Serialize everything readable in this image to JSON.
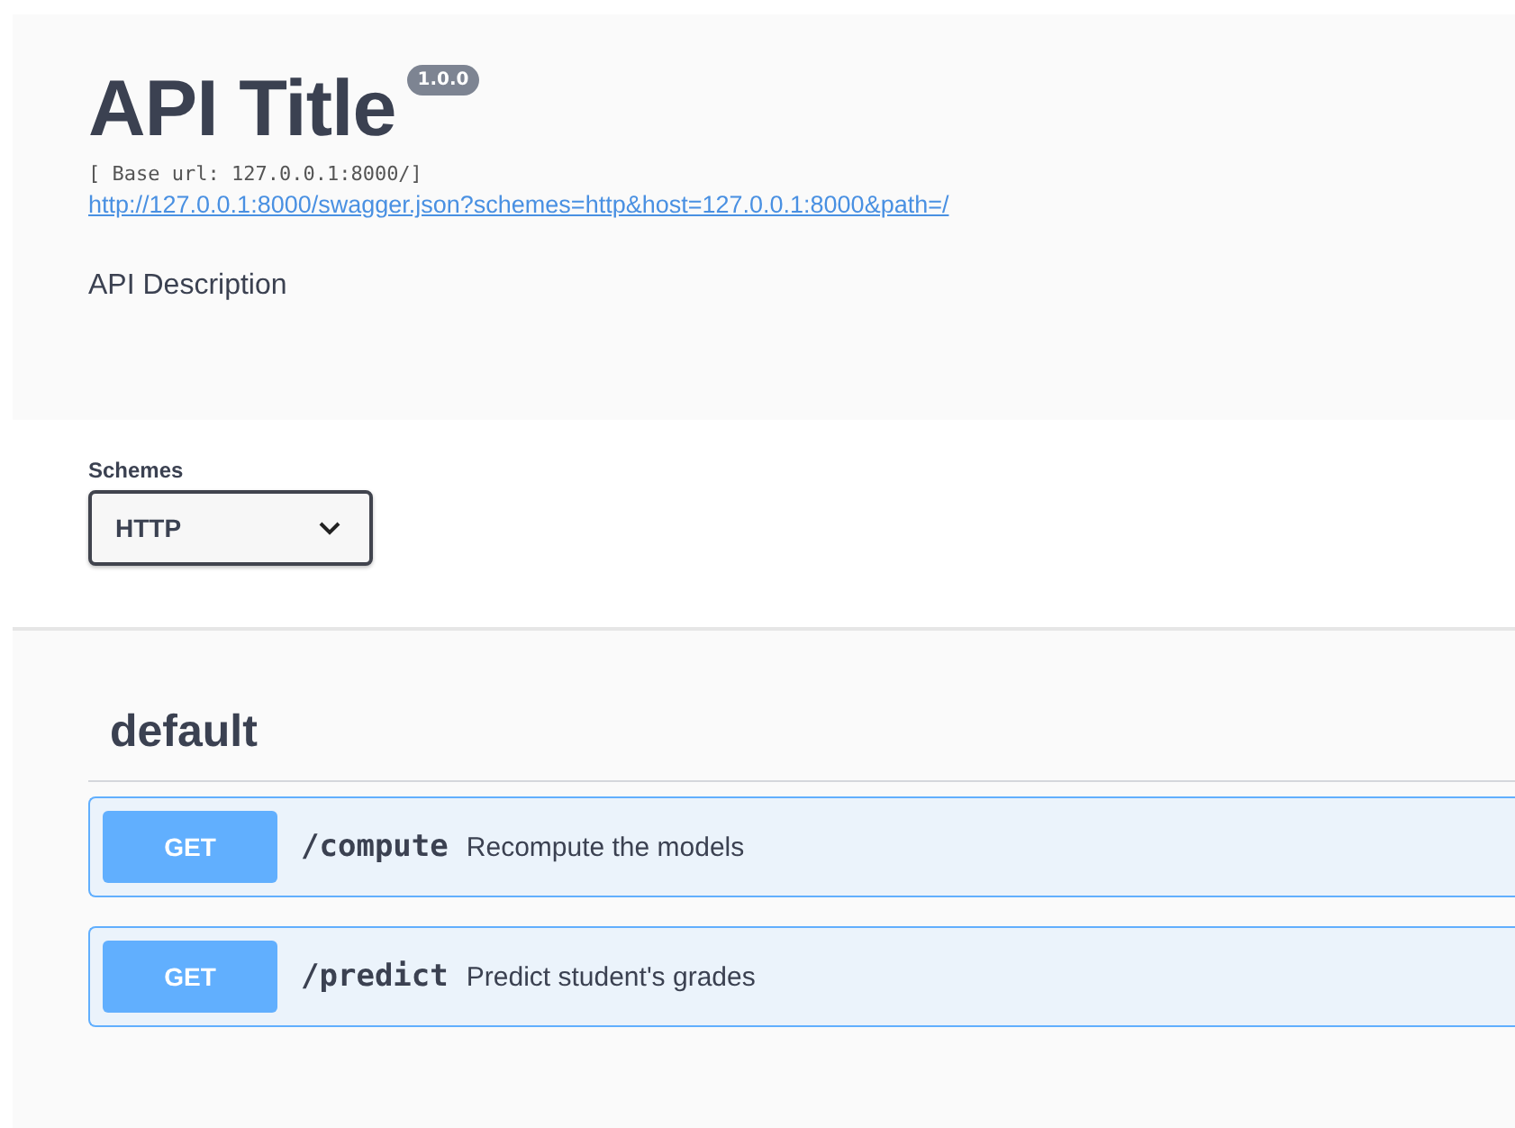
{
  "info": {
    "title": "API Title",
    "version": "1.0.0",
    "base_url": "[ Base url: 127.0.0.1:8000/]",
    "spec_link": "http://127.0.0.1:8000/swagger.json?schemes=http&host=127.0.0.1:8000&path=/",
    "description": "API Description"
  },
  "schemes": {
    "label": "Schemes",
    "value": "HTTP"
  },
  "tag": {
    "name": "default"
  },
  "operations": [
    {
      "kind": "get",
      "method": "GET",
      "path": "/compute",
      "summary": "Recompute the models"
    },
    {
      "kind": "get",
      "method": "GET",
      "path": "/predict",
      "summary": "Predict student's grades"
    }
  ]
}
